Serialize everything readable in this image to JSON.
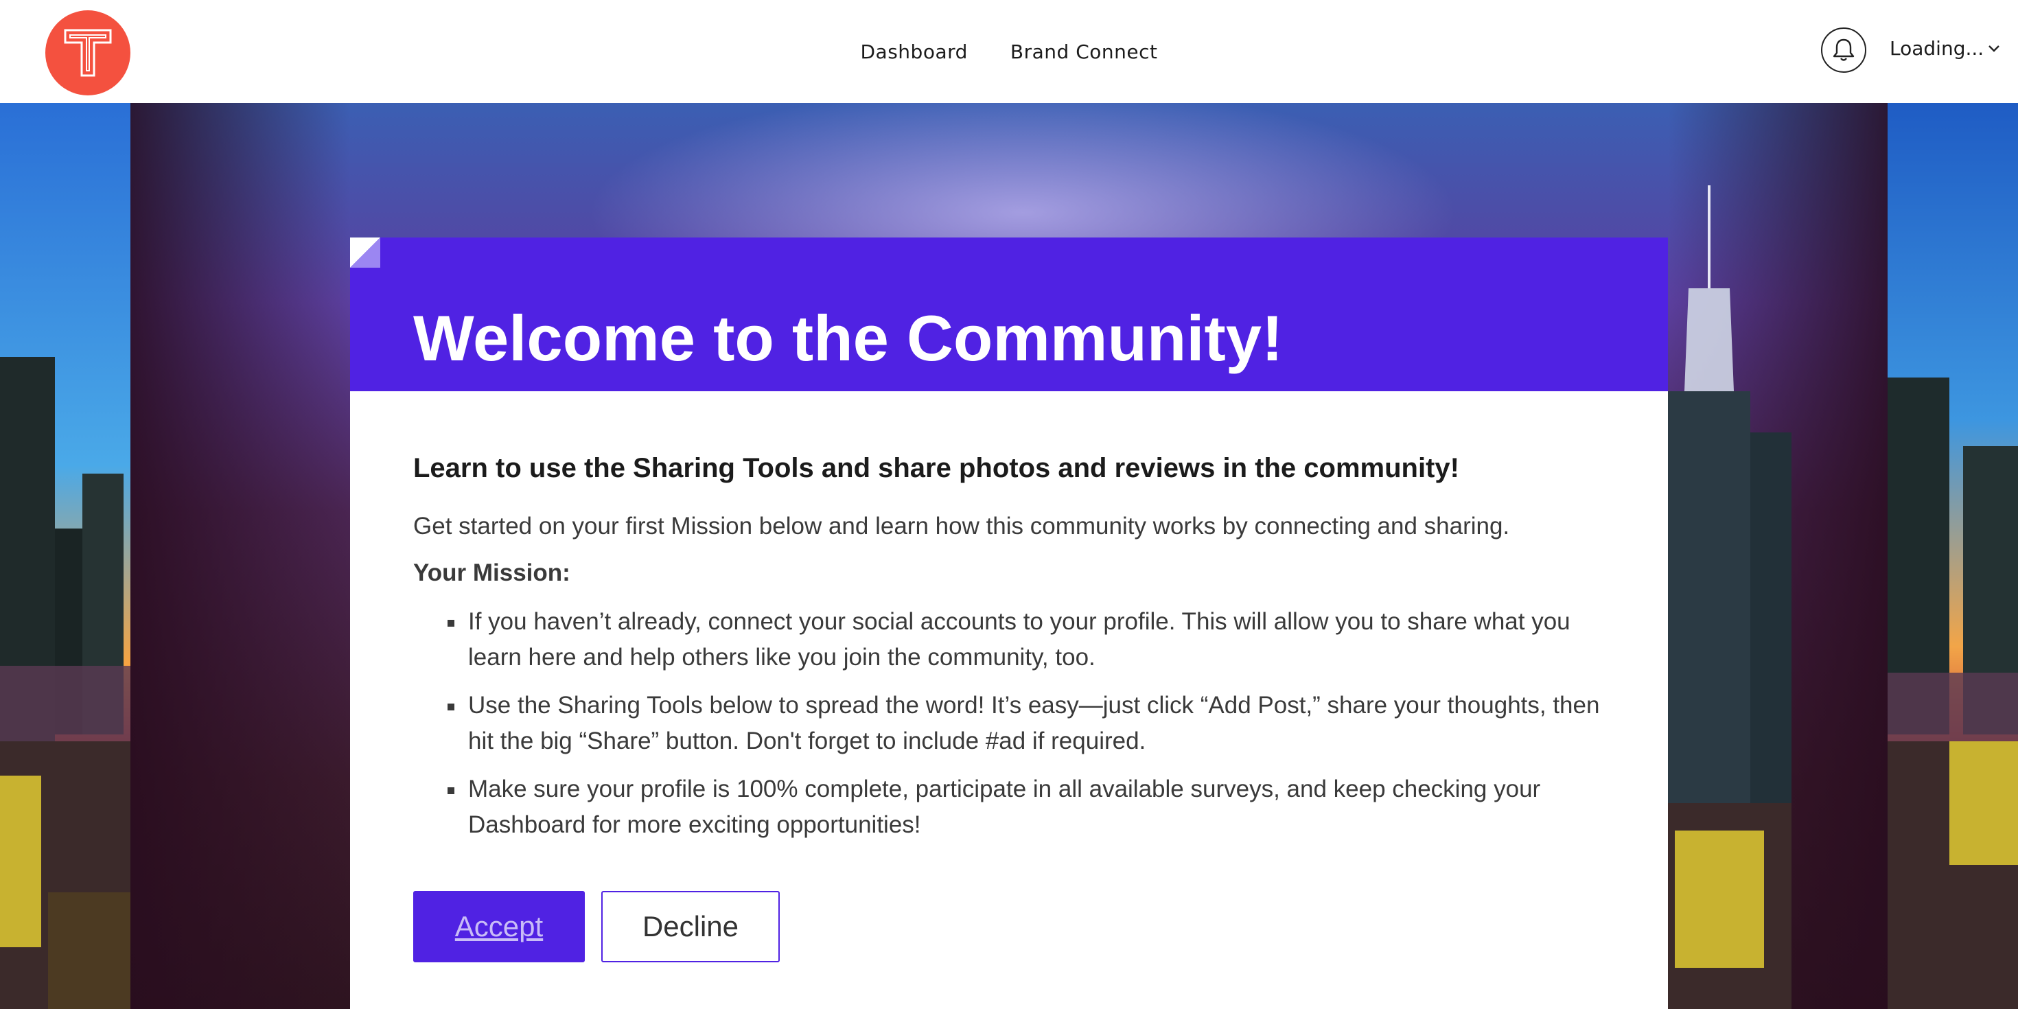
{
  "header": {
    "logo_letter": "T",
    "nav": {
      "dashboard": "Dashboard",
      "brand_connect": "Brand Connect"
    },
    "user_label": "Loading...",
    "icons": {
      "notifications": "bell-icon",
      "user_menu": "chevron-down-icon"
    }
  },
  "card": {
    "title": "Welcome to the Community!",
    "subtitle": "Learn to use the Sharing Tools and share photos and reviews in the community!",
    "intro": "Get started on your first Mission below and learn how this community works by connecting and sharing.",
    "mission_label": "Your Mission:",
    "bullets": [
      "If you haven’t already, connect your social accounts to your profile. This will allow you to share what you learn here and help others like you join the community, too.",
      "Use the Sharing Tools below to spread the word! It’s easy—just click “Add Post,” share your thoughts, then hit the big “Share” button. Don't forget to include #ad if required.",
      "Make sure your profile is 100% complete, participate in all available surveys, and keep checking your Dashboard for more exciting opportunities!"
    ],
    "buttons": {
      "accept": "Accept",
      "decline": "Decline"
    }
  },
  "colors": {
    "logo": "#f4513f",
    "accent": "#5022e3",
    "header_bg": "#ffffff",
    "accept_text": "#c9bcf7"
  }
}
